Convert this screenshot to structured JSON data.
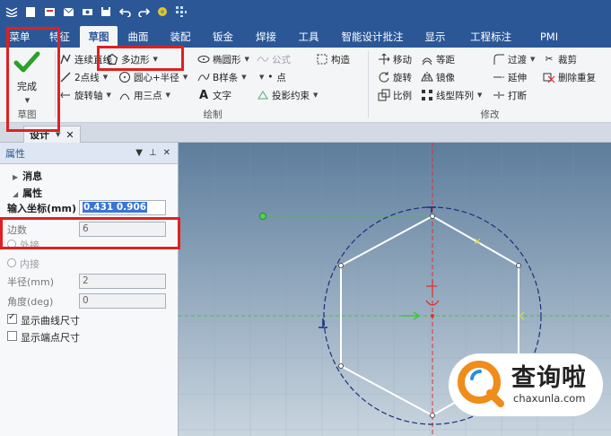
{
  "colors": {
    "ribbon_blue": "#2b5797",
    "highlight_red": "#e02020",
    "canvas_top": "#5d7d9c",
    "canvas_bottom": "#c9d5df",
    "sketch_white": "#ffffff",
    "axis_green": "#3cc83c",
    "axis_red": "#e03030",
    "construction_circle": "#1c2f7a"
  },
  "quick_access": {
    "icons": [
      "app-menu-icon",
      "new-icon",
      "open-icon",
      "mail-icon",
      "print-icon",
      "save-icon",
      "undo-icon",
      "redo-icon",
      "render-icon",
      "grid-icon"
    ]
  },
  "tabs": [
    "菜单",
    "特征",
    "草图",
    "曲面",
    "装配",
    "钣金",
    "焊接",
    "工具",
    "智能设计批注",
    "显示",
    "工程标注",
    "PMI"
  ],
  "ribbon": {
    "finish": {
      "label": "完成",
      "group": "草图"
    },
    "draw_group_label": "绘制",
    "modify_group_label": "修改",
    "draw_items": {
      "connected_line": "连续直线",
      "polygon": "多边形",
      "ellipse": "椭圆形",
      "formula": "公式",
      "construct": "构造",
      "two_point_line": "2点线",
      "center_radius": "圆心+半径",
      "bspline": "B样条",
      "point": "点",
      "rotate_axis": "旋转轴",
      "three_point": "用三点",
      "text": "文字",
      "projection": "投影约束"
    },
    "modify_items": {
      "move": "移动",
      "offset": "等距",
      "transition": "过渡",
      "trim": "裁剪",
      "rotate": "旋转",
      "mirror": "镜像",
      "extend": "延伸",
      "delete_dup": "删除重复",
      "scale": "比例",
      "linear_array": "线型阵列",
      "break": "打断"
    }
  },
  "doc_tab": {
    "label": "设计"
  },
  "panel": {
    "title": "属性",
    "section_message": "消息",
    "section_properties": "属性",
    "input_coords": {
      "label": "输入坐标(mm)",
      "value": "0.431 0.906"
    },
    "sides": {
      "label": "边数",
      "value": "6"
    },
    "circumscribed": "外接",
    "inscribed": "内接",
    "radius": {
      "label": "半径(mm)",
      "value": "2"
    },
    "angle": {
      "label": "角度(deg)",
      "value": "0"
    },
    "show_curve_dim": "显示曲线尺寸",
    "show_endpoint_dim": "显示端点尺寸"
  },
  "watermark": {
    "name": "查询啦",
    "url": "chaxunla.com"
  }
}
